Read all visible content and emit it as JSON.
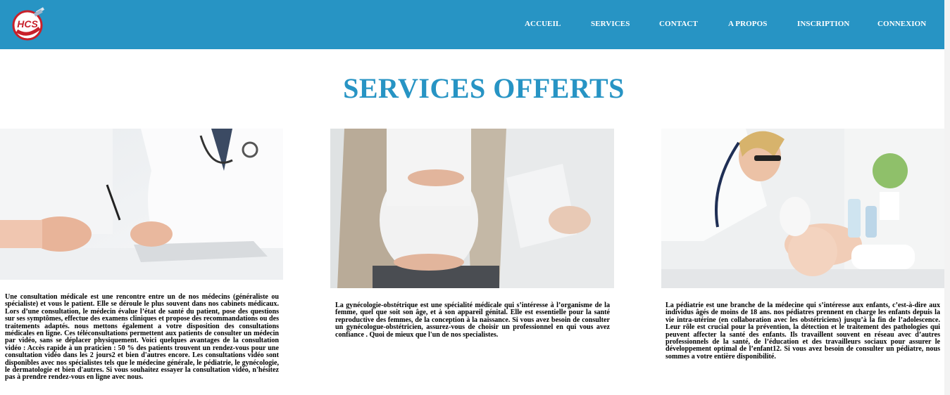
{
  "header": {
    "logo_text": "HCS",
    "nav": [
      "ACCUEIL",
      "SERVICES",
      "CONTACT",
      "A PROPOS",
      "INSCRIPTION",
      "CONNEXION"
    ]
  },
  "page": {
    "title": "SERVICES OFFERTS"
  },
  "services": [
    {
      "image_name": "consultation-photo",
      "text": "Une consultation médicale est une rencontre entre un de nos médecins (généraliste ou spécialiste) et vous le patient. Elle se déroule le plus souvent dans nos cabinets médicaux. Lors d’une consultation, le médecin évalue l’état de santé du patient, pose des questions sur ses symptômes, effectue des examens cliniques et propose des recommandations ou des traitements adaptés. nous mettons également a votre disposition des consultations médicales en ligne. Ces téléconsultations permettent aux patients de consulter un médecin par vidéo, sans se déplacer physiquement. Voici quelques avantages de la consultation vidéo : Accès rapide à un praticien : 50 % des patients trouvent un rendez-vous pour une consultation vidéo dans les 2 jours2 et bien d'autres encore. Les consultations vidéo sont disponibles avec nos spécialistes tels que le médecine générale, le pédiatrie, le gynécologie, le dermatologie et bien d'autres. Si vous souhaitez essayer la consultation vidéo, n'hésitez pas à prendre rendez-vous en ligne avec nous."
    },
    {
      "image_name": "pregnancy-photo",
      "text": "La gynécologie-obstétrique est une spécialité médicale qui s’intéresse à l’organisme de la femme, quel que soit son âge, et à son appareil génital. Elle est essentielle pour la santé reproductive des femmes, de la conception à la naissance. Si vous avez besoin de consulter un gynécologue-obstétricien, assurez-vous de choisir un professionnel en qui vous avez confiance . Quoi de mieux que l'un de nos specialistes."
    },
    {
      "image_name": "pediatrics-photo",
      "text": "La pédiatrie est une branche de la médecine qui s’intéresse aux enfants, c’est-à-dire aux individus âgés de moins de 18 ans. nos pédiatres prennent en charge les enfants depuis la vie intra-utérine (en collaboration avec les obstétriciens) jusqu’à la fin de l’adolescence. Leur rôle est crucial pour la prévention, la détection et le traitement des pathologies qui peuvent affecter la santé des enfants. Ils travaillent souvent en réseau avec d’autres professionnels de la santé, de l’éducation et des travailleurs sociaux pour assurer le développement optimal de l’enfant12. Si vous avez besoin de consulter un pédiatre, nous sommes a votre entière disponibilité."
    }
  ]
}
